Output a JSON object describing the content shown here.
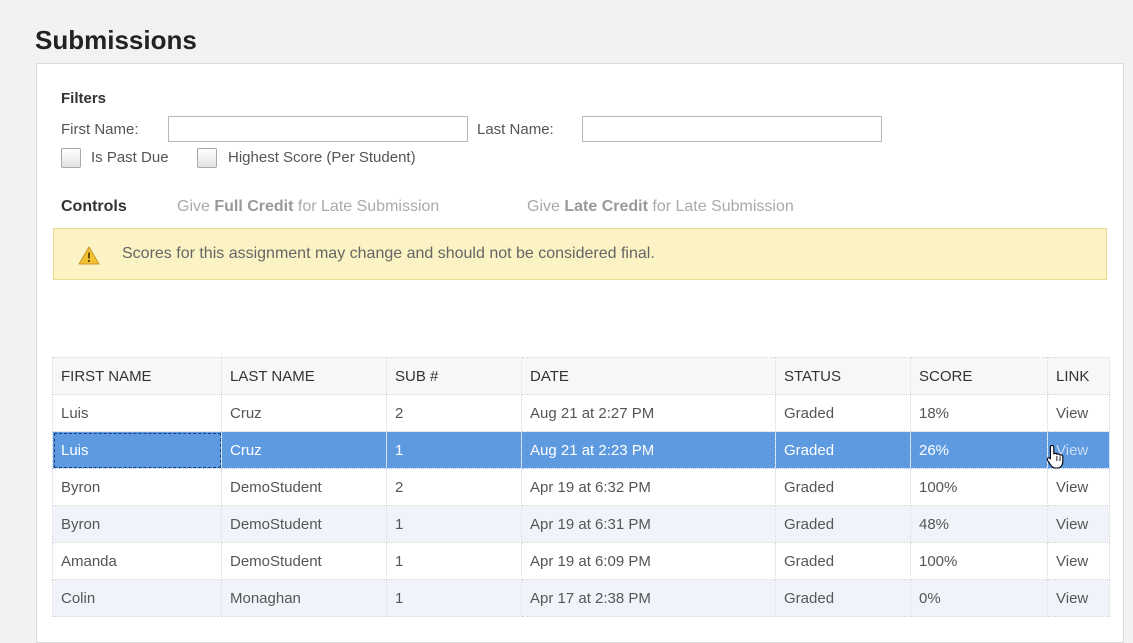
{
  "page_title": "Submissions",
  "filters": {
    "heading": "Filters",
    "first_name_label": "First Name:",
    "first_name_value": "",
    "last_name_label": "Last Name:",
    "last_name_value": "",
    "past_due_label": "Is Past Due",
    "past_due_checked": false,
    "highest_score_label": "Highest Score (Per Student)",
    "highest_score_checked": false
  },
  "controls": {
    "heading": "Controls",
    "full_credit": {
      "pre": "Give ",
      "bold": "Full Credit",
      "post": " for Late Submission"
    },
    "late_credit": {
      "pre": "Give ",
      "bold": "Late Credit",
      "post": " for Late Submission"
    }
  },
  "alert": {
    "icon": "warning-icon",
    "text": "Scores for this assignment may change and should not be considered final."
  },
  "table": {
    "columns": [
      "FIRST NAME",
      "LAST NAME",
      "SUB #",
      "DATE",
      "STATUS",
      "SCORE",
      "LINK"
    ],
    "selected_row": 1,
    "rows": [
      [
        "Luis",
        "Cruz",
        "2",
        "Aug 21 at 2:27 PM",
        "Graded",
        "18%",
        "View"
      ],
      [
        "Luis",
        "Cruz",
        "1",
        "Aug 21 at 2:23 PM",
        "Graded",
        "26%",
        "View"
      ],
      [
        "Byron",
        "DemoStudent",
        "2",
        "Apr 19 at 6:32 PM",
        "Graded",
        "100%",
        "View"
      ],
      [
        "Byron",
        "DemoStudent",
        "1",
        "Apr 19 at 6:31 PM",
        "Graded",
        "48%",
        "View"
      ],
      [
        "Amanda",
        "DemoStudent",
        "1",
        "Apr 19 at 6:09 PM",
        "Graded",
        "100%",
        "View"
      ],
      [
        "Colin",
        "Monaghan",
        "1",
        "Apr 17 at 2:38 PM",
        "Graded",
        "0%",
        "View"
      ]
    ]
  },
  "cursor": "hand-pointer-icon"
}
